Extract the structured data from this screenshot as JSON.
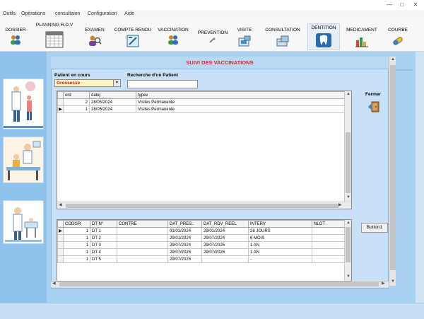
{
  "window": {
    "minimize": "—",
    "maximize": "□",
    "close": "✕"
  },
  "menu": [
    "Outils",
    "Opérations",
    "consultaion",
    "Configuration",
    "Aide"
  ],
  "toolbar": [
    {
      "label": "DOSSIER",
      "icon": "people-icon"
    },
    {
      "label": "PLANNING R.D.V",
      "icon": "calendar-icon"
    },
    {
      "label": "EXAMEN",
      "icon": "magnifier-person-icon"
    },
    {
      "label": "COMPTE RENDU",
      "icon": "report-icon"
    },
    {
      "label": "VACCINATION",
      "icon": "people-icon"
    },
    {
      "label": "PREVENTION",
      "icon": "prevention-icon"
    },
    {
      "label": "VISITE",
      "icon": "visit-icon"
    },
    {
      "label": "CONSULTATION",
      "icon": "consultation-icon"
    },
    {
      "label": "DENTITION",
      "icon": "tooth-icon"
    },
    {
      "label": "MEDICAMENT",
      "icon": "medicine-chart-icon"
    },
    {
      "label": "COURBE",
      "icon": "curve-icon"
    }
  ],
  "form": {
    "title": "SUIVI DES VACCINATIONS",
    "patient_label": "Patient en  cours",
    "patient_value": "Grossesse",
    "search_label": "Recherche d'un Patient",
    "search_value": "",
    "fermer_label": "Fermer",
    "button1_label": "Button1"
  },
  "grid1": {
    "headers": [
      "ord",
      "datej",
      "typev"
    ],
    "rows": [
      {
        "ord": "2",
        "datej": "28/05/2024",
        "typev": "Visites Permanente",
        "indicator": ""
      },
      {
        "ord": "1",
        "datej": "28/05/2024",
        "typev": "Visites Permanente",
        "indicator": "▶"
      }
    ]
  },
  "grid2": {
    "headers": [
      "CODGR",
      "DT N°",
      "CONTRE",
      "DAT_PRES..",
      "DAT_RDV_REEL",
      "INTERV",
      "NLOT"
    ],
    "rows": [
      {
        "indicator": "▶",
        "codgr": "1",
        "dt": "DT 1",
        "contre": "",
        "pres": "01/01/2024",
        "rdv": "29/01/2024",
        "interv": "28 JOURS",
        "nlot": ""
      },
      {
        "indicator": "",
        "codgr": "1",
        "dt": "DT 2",
        "contre": "",
        "pres": "29/01/2024",
        "rdv": "29/07/2024",
        "interv": "6 MOIS",
        "nlot": ""
      },
      {
        "indicator": "",
        "codgr": "1",
        "dt": "DT 3",
        "contre": "",
        "pres": "29/07/2024",
        "rdv": "29/07/2025",
        "interv": "1 AN",
        "nlot": ""
      },
      {
        "indicator": "",
        "codgr": "1",
        "dt": "DT 4",
        "contre": "",
        "pres": "29/07/2025",
        "rdv": "29/07/2026",
        "interv": "1 AN",
        "nlot": ""
      },
      {
        "indicator": "",
        "codgr": "1",
        "dt": "DT 5",
        "contre": "",
        "pres": "29/07/2026",
        "rdv": "",
        "interv": "-",
        "nlot": ""
      }
    ]
  },
  "colors": {
    "caption": "#d62828",
    "combo_bg": "#fff3c2",
    "panel": "#8fc2ec",
    "frame": "#a9d1f2"
  }
}
